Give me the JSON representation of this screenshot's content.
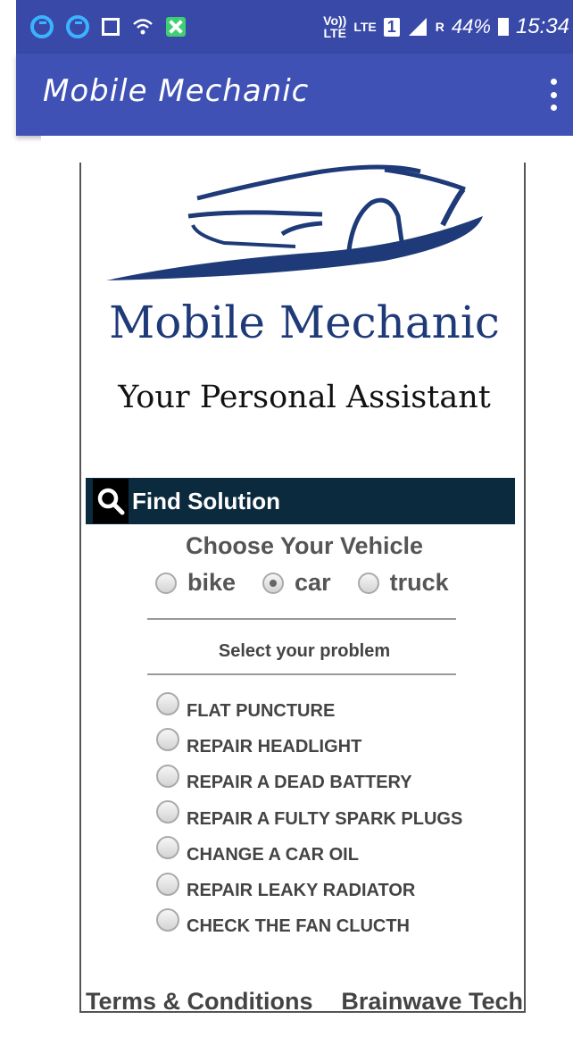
{
  "status_bar": {
    "volte": "Vo))",
    "volte_sub": "LTE",
    "lte": "LTE",
    "sim": "1",
    "roaming": "R",
    "battery": "44%",
    "time": "15:34"
  },
  "app_bar": {
    "title": "Mobile Mechanic"
  },
  "logo": {
    "title": "Mobile Mechanic",
    "subtitle": "Your Personal Assistant"
  },
  "find": {
    "label": "Find Solution"
  },
  "vehicle": {
    "title": "Choose Your Vehicle",
    "options": [
      {
        "label": "bike",
        "checked": false
      },
      {
        "label": "car",
        "checked": true
      },
      {
        "label": "truck",
        "checked": false
      }
    ]
  },
  "problem": {
    "label": "Select your problem",
    "items": [
      "FLAT PUNCTURE",
      "REPAIR HEADLIGHT",
      "REPAIR A DEAD BATTERY",
      "REPAIR A FULTY SPARK PLUGS",
      "CHANGE A CAR OIL",
      "REPAIR LEAKY RADIATOR",
      "CHECK THE FAN CLUCTH"
    ]
  },
  "footer": {
    "terms": "Terms & Conditions",
    "company": "Brainwave Tech"
  },
  "colors": {
    "status_bar": "#3949a8",
    "app_bar": "#3f51b5",
    "find_bar": "#0c2a3e",
    "logo_blue": "#1e3a78"
  }
}
